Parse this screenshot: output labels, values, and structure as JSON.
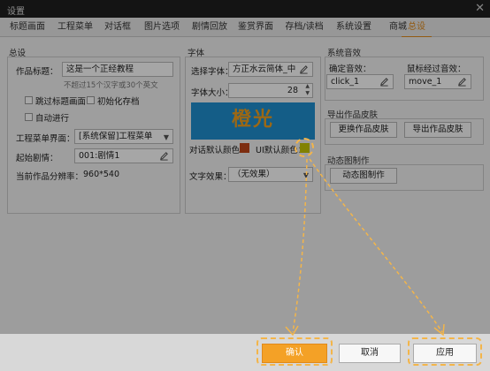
{
  "window": {
    "title": "设置",
    "close_glyph": "✕"
  },
  "tabs": [
    {
      "label": "标题画面"
    },
    {
      "label": "工程菜单"
    },
    {
      "label": "对话框"
    },
    {
      "label": "图片选项"
    },
    {
      "label": "剧情回放"
    },
    {
      "label": "鉴赏界面"
    },
    {
      "label": "存档/读档"
    },
    {
      "label": "系统设置"
    },
    {
      "label": "商城"
    },
    {
      "label": "总设",
      "active": true
    }
  ],
  "general": {
    "title": "总设",
    "work_title_label": "作品标题：",
    "work_title_value": "这是一个正经教程",
    "work_title_hint": "不超过15个汉字或30个英文",
    "skip_title": "跳过标题画面",
    "init_save": "初始化存档",
    "auto_run": "自动进行",
    "project_menu_label": "工程菜单界面：",
    "project_menu_value": "[系统保留]工程菜单",
    "start_story_label": "起始剧情：",
    "start_story_value": "001:剧情1",
    "resolution_label": "当前作品分辨率：",
    "resolution_value": "960*540"
  },
  "font": {
    "title": "字体",
    "select_label": "选择字体：",
    "select_value": "方正水云简体_中",
    "size_label": "字体大小：",
    "size_value": "28",
    "preview_text": "橙光",
    "dialog_color_label": "对话默认颜色：",
    "ui_color_label": "UI默认颜色：",
    "effect_label": "文字效果：",
    "effect_value": "（无效果）",
    "colors": {
      "dialog": "#c0461a",
      "ui": "#c8c800",
      "preview_bg": "#1f8fd0",
      "preview_text": "#f0a020"
    }
  },
  "sound": {
    "title": "系统音效",
    "confirm_label": "确定音效：",
    "confirm_value": "click_1",
    "hover_label": "鼠标经过音效：",
    "hover_value": "move_1"
  },
  "skin": {
    "title": "导出作品皮肤",
    "replace_label": "更换作品皮肤",
    "export_label": "导出作品皮肤"
  },
  "anim": {
    "title": "动态图制作",
    "button_label": "动态图制作"
  },
  "footer": {
    "confirm_label": "确认",
    "cancel_label": "取消",
    "apply_label": "应用",
    "accent": "#f4a126"
  }
}
